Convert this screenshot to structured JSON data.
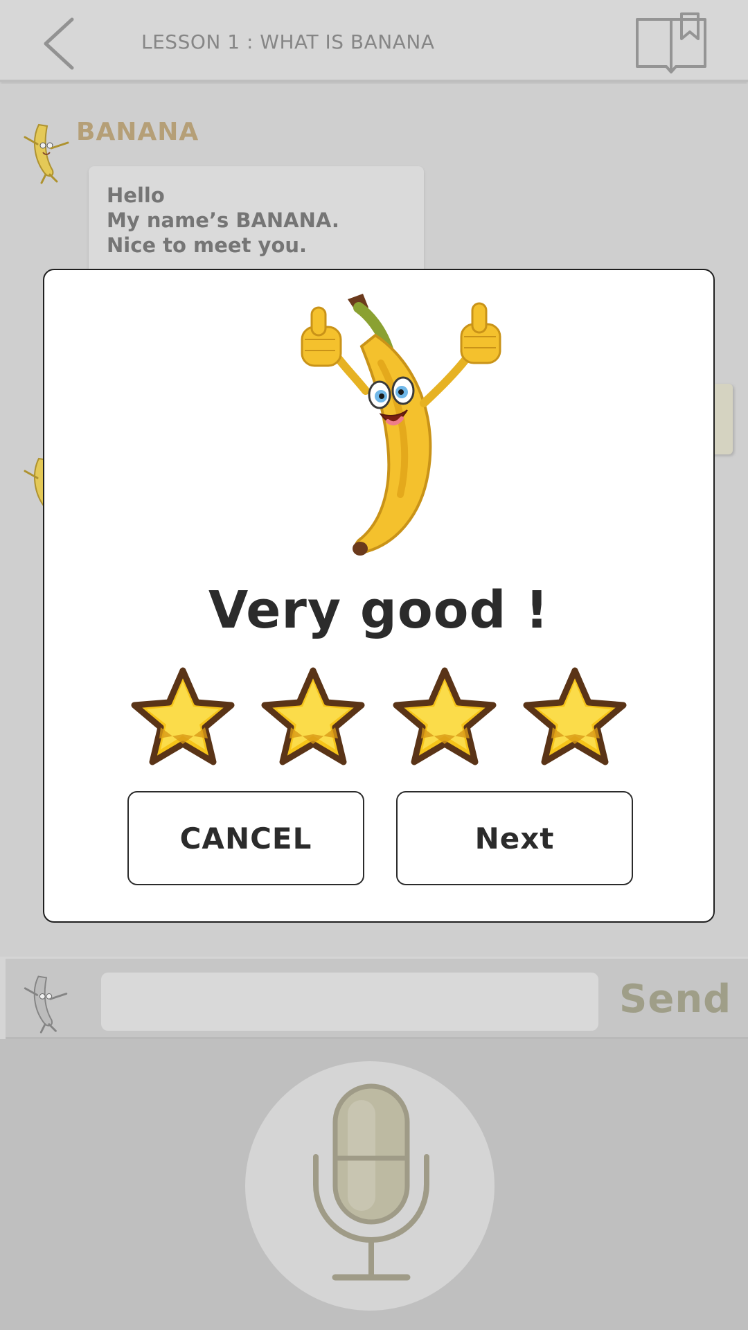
{
  "header": {
    "title": "LESSON 1 : WHAT IS BANANA",
    "back_icon": "chevron-left-icon",
    "book_icon": "book-bookmark-icon"
  },
  "chat": {
    "sender": "BANANA",
    "message_lines": [
      "Hello",
      "My name’s BANANA.",
      "Nice to meet you."
    ]
  },
  "input_bar": {
    "message_value": "",
    "send_label": "Send"
  },
  "mic": {
    "icon": "microphone-icon"
  },
  "dialog": {
    "title": "Very good !",
    "stars_earned": 4,
    "stars_total": 4,
    "cancel_label": "CANCEL",
    "next_label": "Next"
  },
  "colors": {
    "star_fill": "#f6c419",
    "star_outline": "#5a3417",
    "sender_name": "#bfa87c",
    "send_text": "#a8a78f",
    "banana_yellow": "#f4c12d"
  }
}
